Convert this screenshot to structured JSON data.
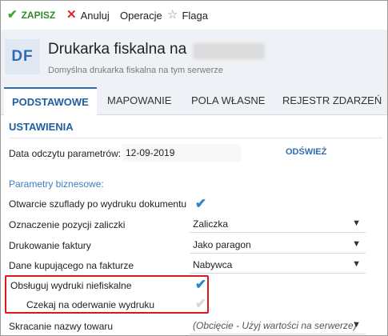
{
  "toolbar": {
    "save_label": "ZAPISZ",
    "cancel_label": "Anuluj",
    "operations_label": "Operacje",
    "flag_label": "Flaga",
    "save_icon": "check-icon",
    "cancel_icon": "x-icon",
    "flag_icon": "star-outline-icon"
  },
  "header": {
    "badge": "DF",
    "title": "Drukarka fiskalna na",
    "subtitle": "Domyślna drukarka fiskalna na tym serwerze"
  },
  "tabs": [
    {
      "label": "PODSTAWOWE",
      "active": true
    },
    {
      "label": "MAPOWANIE",
      "active": false
    },
    {
      "label": "POLA WŁASNE",
      "active": false
    },
    {
      "label": "REJESTR ZDARZEŃ",
      "active": false
    }
  ],
  "settings": {
    "section_title": "USTAWIENIA",
    "read_date_label": "Data odczytu parametrów:",
    "read_date_value": "12-09-2019",
    "refresh_label": "ODŚWIEŻ",
    "business_params_label": "Parametry biznesowe:",
    "rows": [
      {
        "label": "Otwarcie szuflady po wydruku dokumentu",
        "type": "checkbox",
        "checked": true
      },
      {
        "label": "Oznaczenie pozycji zaliczki",
        "type": "select",
        "value": "Zaliczka"
      },
      {
        "label": "Drukowanie faktury",
        "type": "select",
        "value": "Jako paragon"
      },
      {
        "label": "Dane kupującego na fakturze",
        "type": "select",
        "value": "Nabywca"
      },
      {
        "label": "Obsługuj wydruki niefiskalne",
        "type": "checkbox",
        "checked": true
      },
      {
        "label": "Czekaj na oderwanie wydruku",
        "type": "checkbox",
        "checked": true,
        "disabled": true
      },
      {
        "label": "Skracanie nazwy towaru",
        "type": "select",
        "value": "(Obcięcie - Użyj wartości na serwerze)"
      }
    ]
  },
  "colors": {
    "accent": "#2f6db3",
    "save_green": "#3aa53a",
    "cancel_red": "#d9262e",
    "highlight_red": "#e0161d",
    "check_blue": "#2a87d0"
  }
}
